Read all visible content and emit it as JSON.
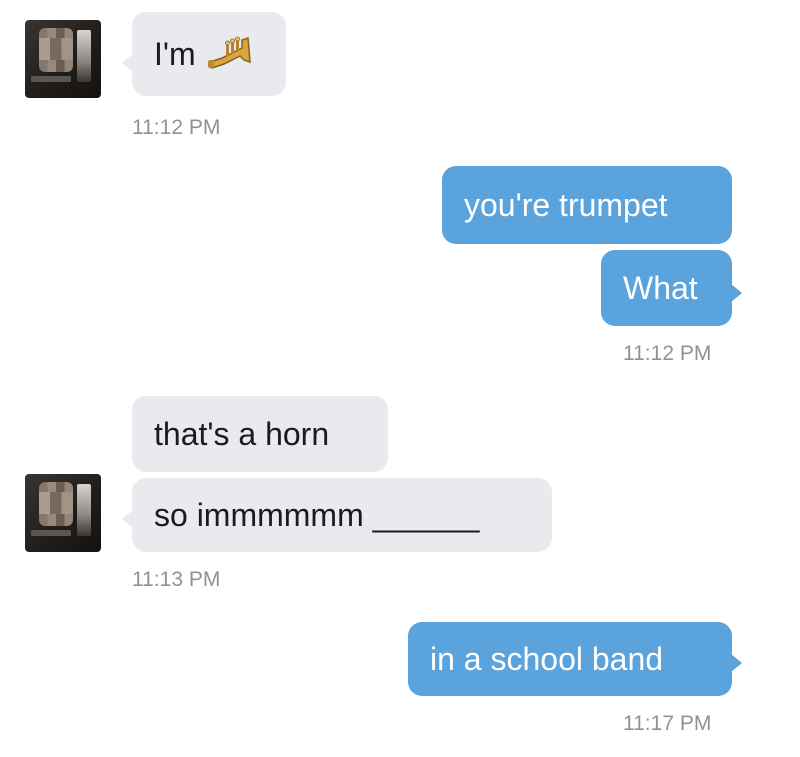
{
  "conversation": {
    "group1": {
      "message": "I'm",
      "emoji": "trumpet-icon",
      "time": "11:12 PM"
    },
    "group2": {
      "messages": [
        "you're trumpet",
        "What"
      ],
      "time": "11:12 PM"
    },
    "group3": {
      "messages": [
        "that's a horn",
        "so immmmmm ______"
      ],
      "time": "11:13 PM"
    },
    "group4": {
      "message": "in a school band",
      "time": "11:17 PM"
    }
  },
  "colors": {
    "sent_bubble": "#5aa3dc",
    "received_bubble": "#e9eaee",
    "timestamp": "#8f9196"
  }
}
